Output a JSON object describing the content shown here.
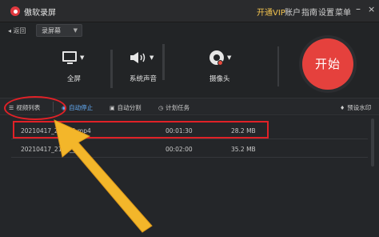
{
  "titlebar": {
    "app_title": "傲软录屏",
    "menu": [
      "开通VIP",
      "账户",
      "指南",
      "设置",
      "菜单"
    ]
  },
  "toolbar": {
    "back_label": "◂ 返回",
    "mode_select": "录屏幕"
  },
  "sources": [
    {
      "label": "全屏",
      "icon": "monitor-icon"
    },
    {
      "label": "系统声音",
      "icon": "speaker-icon"
    },
    {
      "label": "摄像头",
      "icon": "webcam-icon"
    }
  ],
  "start_button": "开始",
  "options": {
    "video_list": "视频列表",
    "auto_stop": "自动停止",
    "auto_split": "自动分割",
    "schedule": "计划任务",
    "watermark": "预设水印"
  },
  "files": [
    {
      "name": "20210417_2__715.mp4",
      "duration": "00:01:30",
      "size": "28.2 MB"
    },
    {
      "name": "20210417_2104__04",
      "duration": "00:02:00",
      "size": "35.2 MB"
    }
  ],
  "colors": {
    "accent_red": "#e5413d",
    "highlight_blue": "#66b2ff",
    "vip_gold": "#f3c44f",
    "annotation_red": "#e02127",
    "arrow_yellow": "#f3b62a"
  }
}
